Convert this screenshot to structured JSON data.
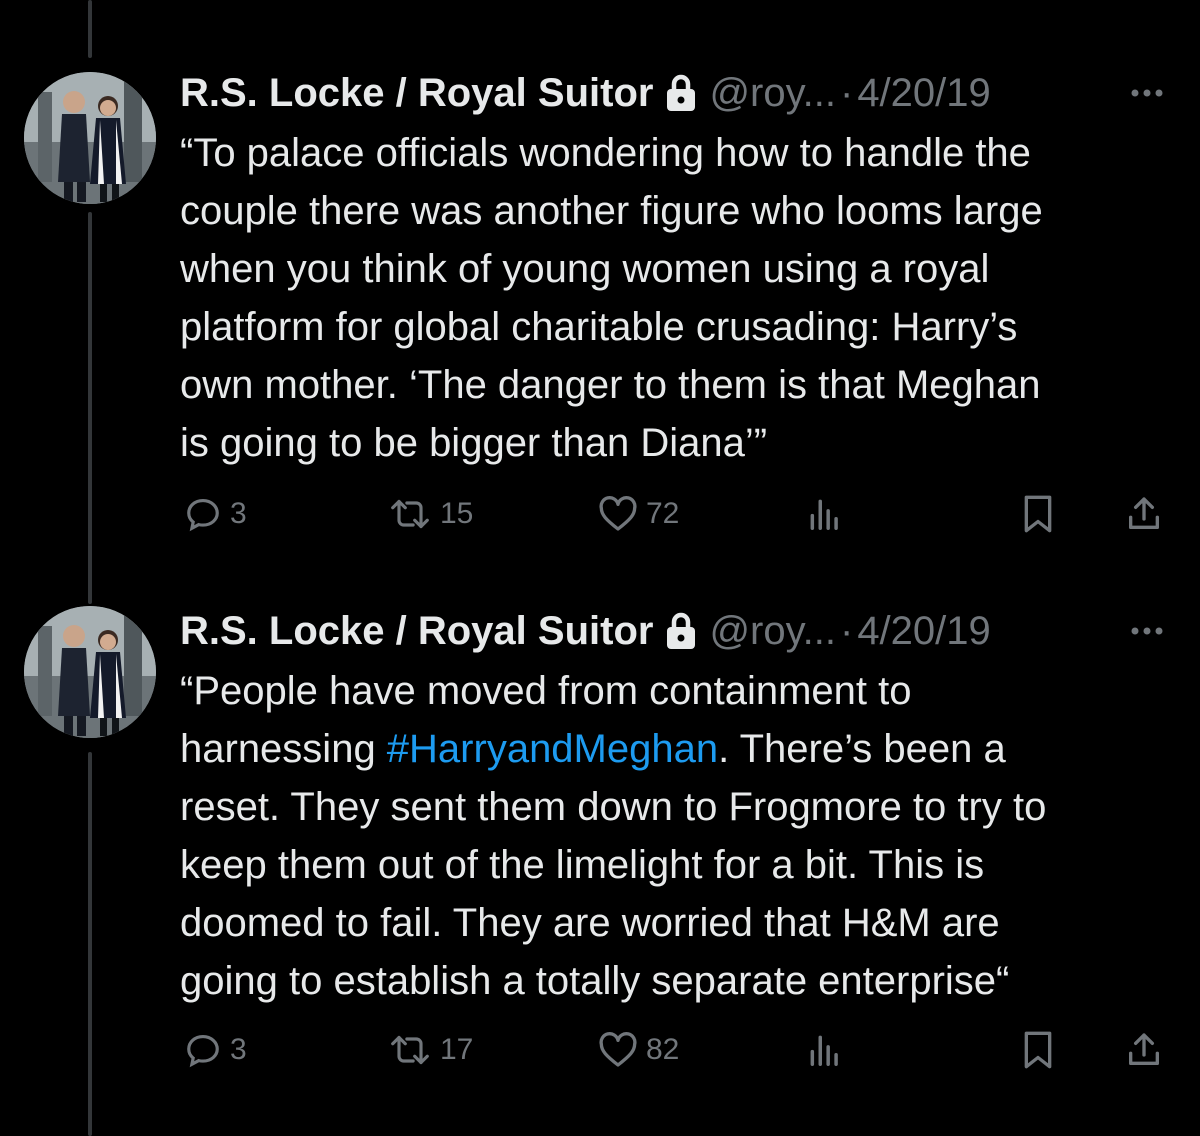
{
  "tweets": [
    {
      "author_name": "R.S. Locke / Royal Suitor",
      "handle": "@roy...",
      "separator": "·",
      "date": "4/20/19",
      "text_lines": [
        "“To palace officials wondering how to handle the",
        "couple there was another figure who looms large",
        "when you think of young women using a royal",
        "platform for global charitable crusading: Harry’s",
        "own mother. ‘The danger to them is that Meghan",
        "is going to be bigger than Diana’”"
      ],
      "replies": "3",
      "retweets": "15",
      "likes": "72"
    },
    {
      "author_name": "R.S. Locke / Royal Suitor",
      "handle": "@roy...",
      "separator": "·",
      "date": "4/20/19",
      "text_line_1": "“People have moved from containment to",
      "text_line_2_prefix": "harnessing ",
      "hashtag": "#HarryandMeghan",
      "text_line_2_suffix": ". There’s been a",
      "text_lines_rest": [
        "reset. They sent them down to Frogmore to try to",
        "keep them out of the limelight for a bit. This is",
        "doomed to fail. They are worried that H&M are",
        "going to establish a totally separate enterprise“"
      ],
      "replies": "3",
      "retweets": "17",
      "likes": "82"
    }
  ],
  "icons": {
    "lock": "lock-icon",
    "more": "more-icon",
    "reply": "reply-icon",
    "retweet": "retweet-icon",
    "like": "like-icon",
    "views": "views-icon",
    "bookmark": "bookmark-icon",
    "share": "share-icon"
  },
  "colors": {
    "background": "#000000",
    "text": "#e7e9ea",
    "secondary": "#71767b",
    "hashtag": "#1d9bf0",
    "thread_line": "#333639"
  }
}
